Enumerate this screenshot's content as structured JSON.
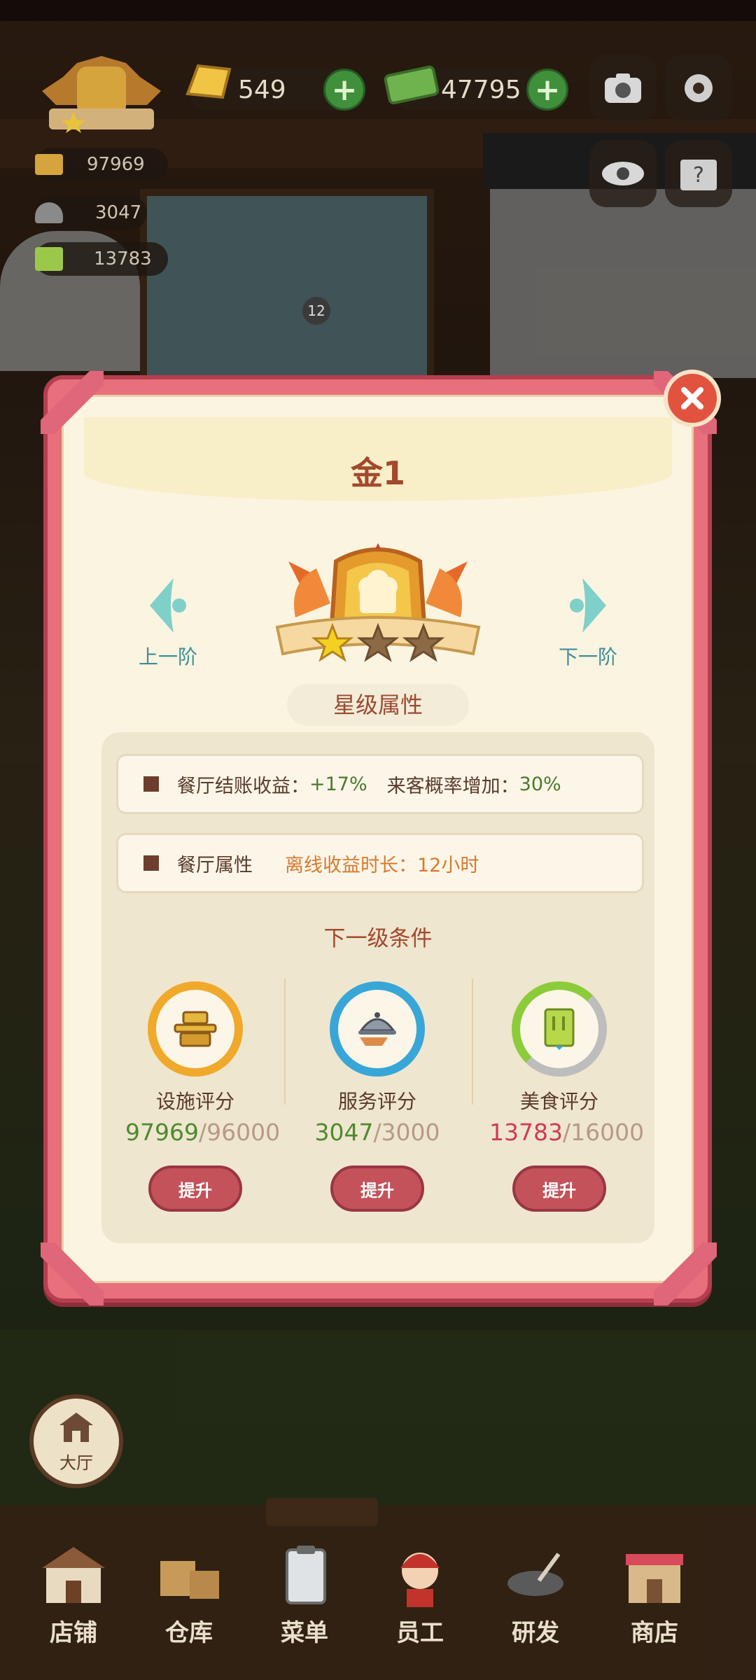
{
  "hud": {
    "gold_value": "549",
    "cash_value": "47795",
    "facility_value": "97969",
    "service_value": "3047",
    "food_value": "13783",
    "stall_badge": "12"
  },
  "dialog": {
    "rank_title": "金1",
    "prev_label": "上一阶",
    "next_label": "下一阶",
    "stars_filled": 1,
    "stars_total": 3,
    "props_title": "星级属性",
    "rows": [
      {
        "label": "餐厅结账收益：",
        "value1": "+17%",
        "label2": "来客概率增加：",
        "value2": "30%"
      },
      {
        "label": "餐厅属性",
        "label2": "离线收益时长：",
        "value2": "12小时"
      }
    ],
    "next_conditions": "下一级条件",
    "scores": [
      {
        "name": "设施评分",
        "current": "97969",
        "target": "/96000",
        "ring_color": "#f0a92a",
        "icon": "facility-icon"
      },
      {
        "name": "服务评分",
        "current": "3047",
        "target": "/3000",
        "ring_color": "#39a6d8",
        "icon": "service-icon"
      },
      {
        "name": "美食评分",
        "current": "13783",
        "target": "/16000",
        "ring_color": "#8ccc3a",
        "icon": "food-icon"
      }
    ],
    "upgrade_label": "提升"
  },
  "bottom": {
    "hall_label": "大厅",
    "tabs": [
      "店铺",
      "仓库",
      "菜单",
      "员工",
      "研发",
      "商店"
    ]
  },
  "colors": {
    "dialog_frame": "#e86f7c",
    "accent": "#a3482d",
    "ok": "#4e8a2f",
    "bad": "#cf3b55"
  }
}
